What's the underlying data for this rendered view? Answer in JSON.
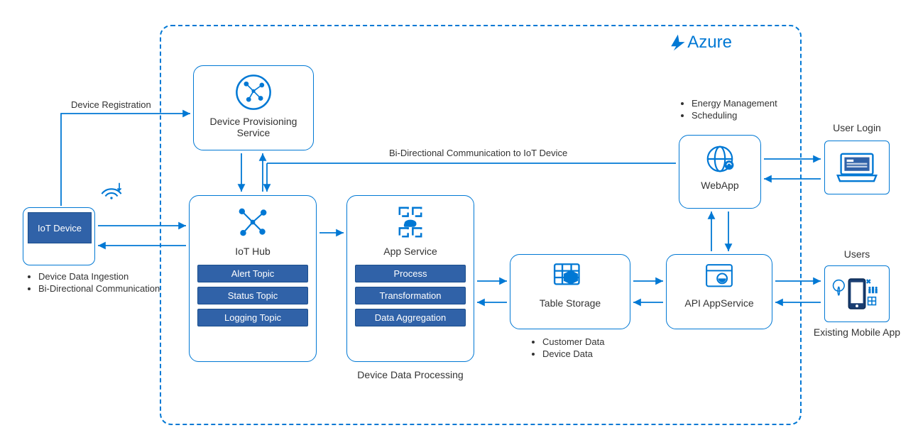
{
  "brand": "Azure",
  "labels": {
    "deviceRegistration": "Device Registration",
    "biDirToIot": "Bi-Directional Communication to IoT Device",
    "deviceDataProcessing": "Device Data Processing",
    "userLogin": "User Login",
    "users": "Users",
    "existingMobileApp": "Existing Mobile App"
  },
  "iotDevice": {
    "title": "IoT Device",
    "bullets": [
      "Device Data Ingestion",
      "Bi-Directional Communication"
    ]
  },
  "dps": {
    "title": "Device Provisioning Service"
  },
  "iotHub": {
    "title": "IoT Hub",
    "topics": [
      "Alert Topic",
      "Status Topic",
      "Logging Topic"
    ]
  },
  "appService": {
    "title": "App Service",
    "items": [
      "Process",
      "Transformation",
      "Data Aggregation"
    ]
  },
  "tableStorage": {
    "title": "Table Storage",
    "bullets": [
      "Customer Data",
      "Device Data"
    ]
  },
  "apiAppService": {
    "title": "API AppService"
  },
  "webApp": {
    "title": "WebApp",
    "bullets": [
      "Energy Management",
      "Scheduling"
    ]
  }
}
